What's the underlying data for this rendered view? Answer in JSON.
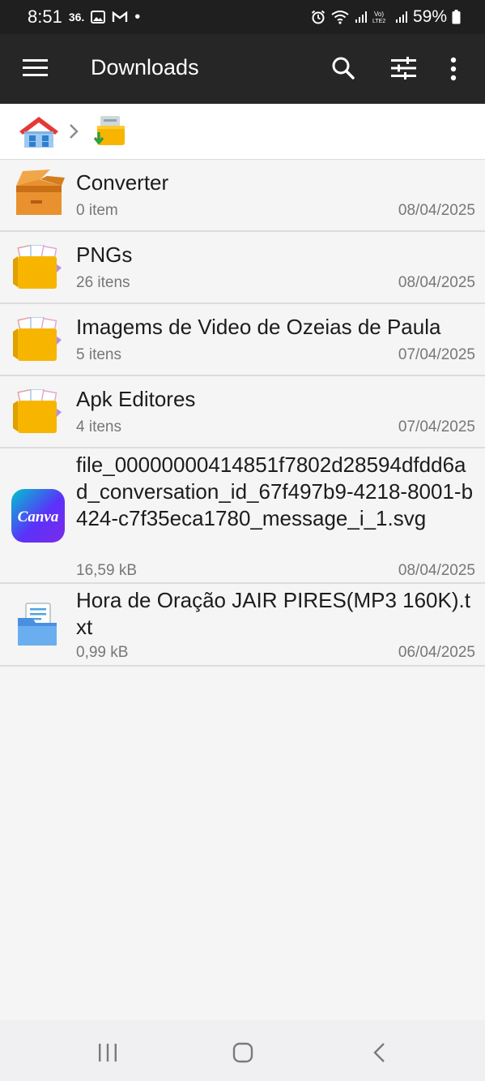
{
  "status_bar": {
    "time": "8:51",
    "notif_badge": "36.",
    "dot": "•",
    "battery": "59%",
    "icons": [
      "image-icon",
      "gmail-icon",
      "alarm-icon",
      "wifi-icon",
      "signal-icon",
      "volte-icon",
      "signal-icon",
      "battery-icon"
    ]
  },
  "app_bar": {
    "title": "Downloads",
    "icons": [
      "menu-icon",
      "search-icon",
      "tune-icon",
      "more-vert-icon"
    ]
  },
  "breadcrumb": {
    "icons": [
      "home-folder-icon",
      "chevron-right-icon",
      "downloads-folder-icon"
    ]
  },
  "files": [
    {
      "name": "Converter",
      "meta": "0 item",
      "date": "08/04/2025",
      "icon": "open-box-icon"
    },
    {
      "name": "PNGs",
      "meta": "26 itens",
      "date": "08/04/2025",
      "icon": "image-folder-icon"
    },
    {
      "name": "Imagems de Video de Ozeias de Paula",
      "meta": "5 itens",
      "date": "07/04/2025",
      "icon": "image-folder-icon"
    },
    {
      "name": "Apk Editores",
      "meta": "4 itens",
      "date": "07/04/2025",
      "icon": "image-folder-icon"
    },
    {
      "name": "file_00000000414851f7802d28594dfdd6ad_conversation_id_67f497b9-4218-8001-b424-c7f35eca1780_message_i_1.svg",
      "meta": "16,59 kB",
      "date": "08/04/2025",
      "icon": "canva-icon",
      "icon_text": "Canva"
    },
    {
      "name": "Hora de Oração JAIR PIRES(MP3 160K).txt",
      "meta": "0,99 kB",
      "date": "06/04/2025",
      "icon": "document-folder-icon"
    }
  ],
  "nav_bar": {
    "icons": [
      "recents-icon",
      "home-icon",
      "back-icon"
    ]
  },
  "colors": {
    "app_bar": "#262626",
    "status_bar": "#1f1f1f",
    "background": "#f5f5f5",
    "folder": "#f7b500",
    "canva_start": "#00c4cc",
    "canva_end": "#7d2ae8"
  }
}
